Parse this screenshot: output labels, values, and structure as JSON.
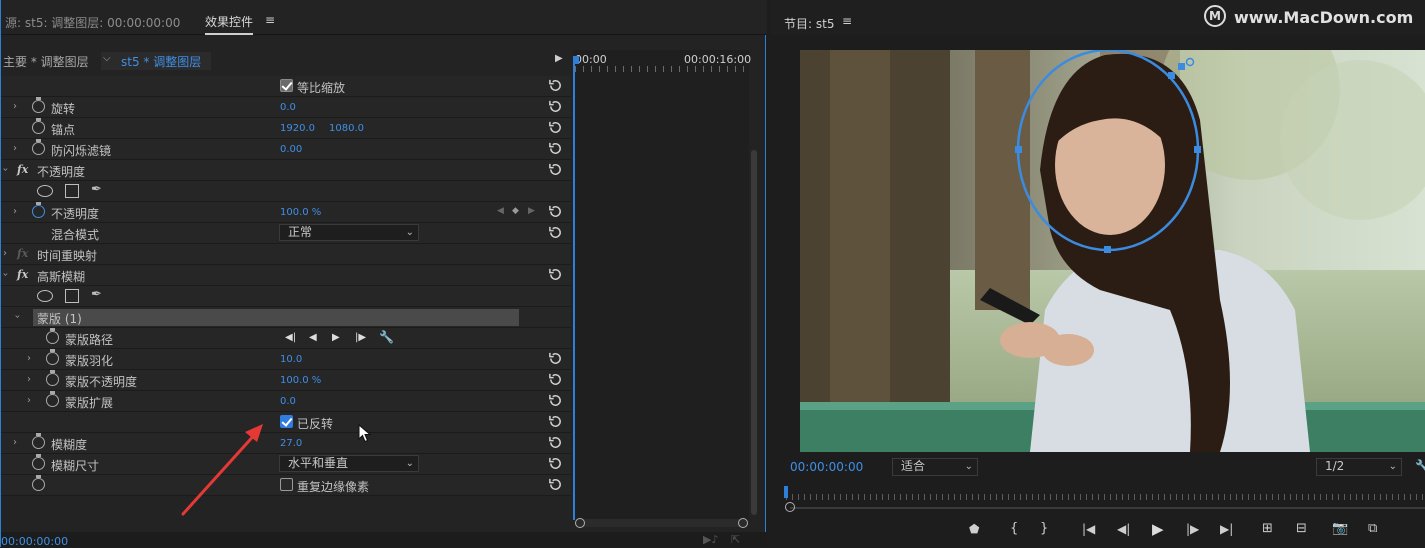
{
  "effects_panel": {
    "source_label": "源: st5: 调整图层: 00:00:00:00",
    "tab_label": "效果控件",
    "menu_icon": "hamburger-icon",
    "breadcrumb_master": "主要 * 调整图层",
    "breadcrumb_clip": "st5 * 调整图层",
    "timecode_start": "00:00",
    "timecode_end": "00:00:16:00",
    "footer_timecode": "00:00:00:00",
    "uniform_scale_label": "等比缩放",
    "rotation": {
      "label": "旋转",
      "value": "0.0"
    },
    "anchor": {
      "label": "锚点",
      "x": "1920.0",
      "y": "1080.0"
    },
    "antiflicker": {
      "label": "防闪烁滤镜",
      "value": "0.00"
    },
    "opacity_section": {
      "label": "不透明度"
    },
    "opacity": {
      "label": "不透明度",
      "value": "100.0 %"
    },
    "blend_mode": {
      "label": "混合模式",
      "value": "正常"
    },
    "time_remap": {
      "label": "时间重映射"
    },
    "gaussian_blur": {
      "label": "高斯模糊"
    },
    "mask": {
      "label": "蒙版 (1)"
    },
    "mask_path": {
      "label": "蒙版路径"
    },
    "mask_feather": {
      "label": "蒙版羽化",
      "value": "10.0"
    },
    "mask_opacity": {
      "label": "蒙版不透明度",
      "value": "100.0 %"
    },
    "mask_expansion": {
      "label": "蒙版扩展",
      "value": "0.0"
    },
    "inverted": {
      "label": "已反转",
      "checked": true
    },
    "blurriness": {
      "label": "模糊度",
      "value": "27.0"
    },
    "blur_dimensions": {
      "label": "模糊尺寸",
      "value": "水平和垂直"
    },
    "repeat_edge": {
      "label": "重复边缘像素",
      "checked": false
    }
  },
  "program_monitor": {
    "title": "节目: st5",
    "timecode": "00:00:00:00",
    "fit_label": "适合",
    "resolution_label": "1/2"
  },
  "watermark": "www.MacDown.com",
  "colors": {
    "accent": "#2d7fd8",
    "value_blue": "#3f8fe6",
    "mask_ellipse": "#3b8be0",
    "arrow_red": "#e53935"
  }
}
